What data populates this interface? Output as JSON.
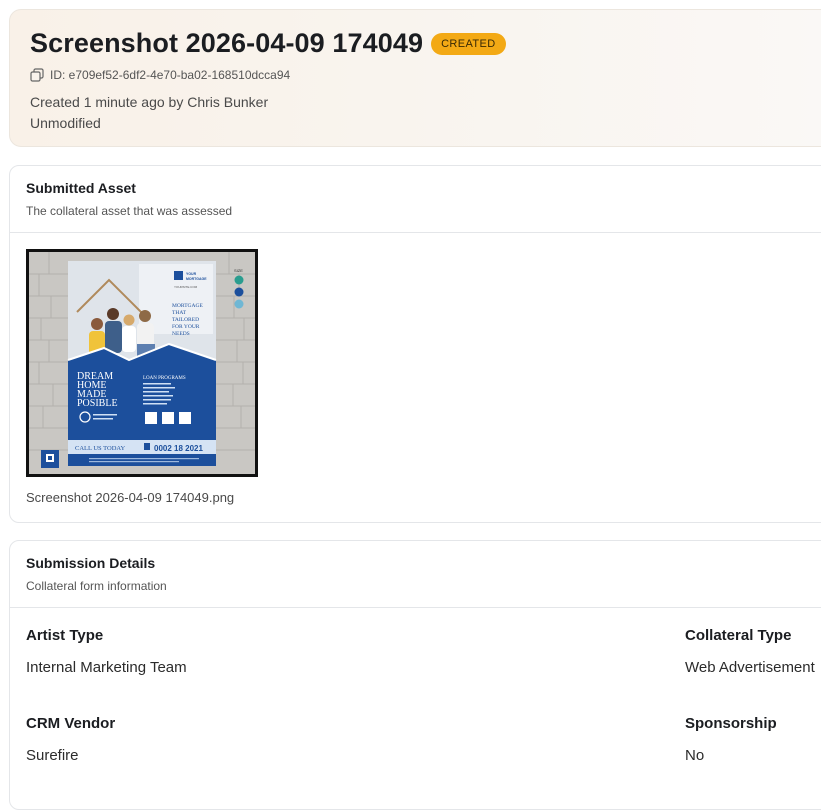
{
  "header": {
    "title": "Screenshot 2026-04-09 174049",
    "status": "CREATED",
    "id_text": "ID: e709ef52-6df2-4e70-ba02-168510dcca94",
    "created_text": "Created 1 minute ago by Chris Bunker",
    "modified_text": "Unmodified"
  },
  "submitted_asset": {
    "title": "Submitted Asset",
    "subtitle": "The collateral asset that was assessed",
    "filename": "Screenshot 2026-04-09 174049.png",
    "thumbnail": {
      "company_line1": "YOUR",
      "company_line2": "MORTGAGE",
      "website": "YOURSITE.COM",
      "size_label": "SIZE",
      "tagline": [
        "MORTGAGE",
        "THAT",
        "TAILORED",
        "FOR YOUR",
        "NEEDS"
      ],
      "headline": [
        "DREAM",
        "HOME",
        "MADE",
        "POSIBLE"
      ],
      "loan_title": "LOAN PROGRAMS",
      "call_label": "CALL US TODAY",
      "phone": "0002 18 2021"
    }
  },
  "submission_details": {
    "title": "Submission Details",
    "subtitle": "Collateral form information",
    "fields": [
      {
        "label": "Artist Type",
        "value": "Internal Marketing Team"
      },
      {
        "label": "Collateral Type",
        "value": "Web Advertisement"
      },
      {
        "label": "CRM Vendor",
        "value": "Surefire"
      },
      {
        "label": "Sponsorship",
        "value": "No"
      }
    ]
  },
  "colors": {
    "badge": "#f3a915",
    "flyer_blue": "#1c4f9c",
    "flyer_light": "#e8eef7"
  }
}
